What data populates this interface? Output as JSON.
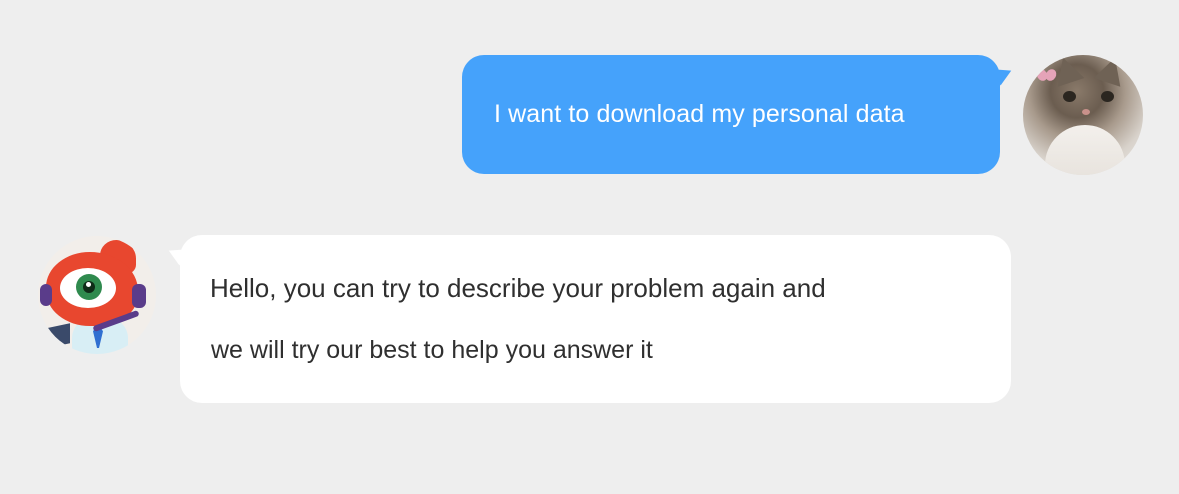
{
  "conversation": {
    "user_message": {
      "text": "I want to download my personal data",
      "bubble_color": "#45a2fb",
      "avatar_icon": "cat-avatar-icon"
    },
    "assistant_message": {
      "lines": [
        "Hello, you can try to describe your problem again and",
        "we will try our best to help you answer it"
      ],
      "bubble_color": "#ffffff",
      "avatar_icon": "support-mascot-avatar-icon"
    }
  },
  "theme": {
    "background": "#eeeeee",
    "text_dark": "#2f2f2f",
    "text_light": "#ffffff"
  }
}
